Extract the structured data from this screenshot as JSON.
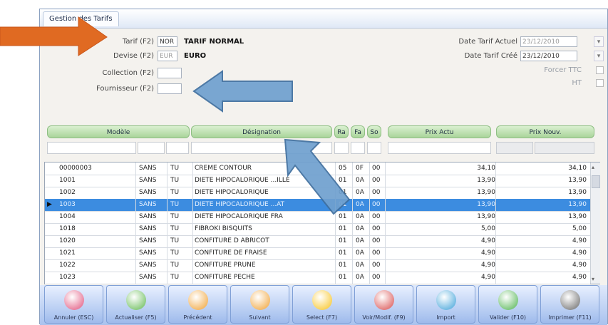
{
  "window": {
    "tab_label": "Gestion des Tarifs"
  },
  "form": {
    "tarif_label": "Tarif (F2)",
    "tarif_code": "NOR",
    "tarif_name": "TARIF NORMAL",
    "devise_label": "Devise (F2)",
    "devise_code": "EUR",
    "devise_name": "EURO",
    "collection_label": "Collection (F2)",
    "fournisseur_label": "Fournisseur (F2)",
    "date_actuel_label": "Date Tarif Actuel",
    "date_actuel": "23/12/2010",
    "date_cree_label": "Date Tarif Créé",
    "date_cree": "23/12/2010",
    "forcer_ttc_label": "Forcer TTC",
    "ht_label": "HT"
  },
  "columns": {
    "modele": "Modèle",
    "designation": "Désignation",
    "ra": "Ra",
    "fa": "Fa",
    "so": "So",
    "prix_actu": "Prix Actu",
    "prix_nouv": "Prix Nouv."
  },
  "rows": [
    {
      "modele": "00000003",
      "c1": "SANS",
      "c2": "TU",
      "designation": "CREME CONTOUR",
      "ra": "05",
      "fa": "0F",
      "so": "00",
      "prix_actu": "34,10",
      "prix_nouv": "34,10"
    },
    {
      "modele": "1001",
      "c1": "SANS",
      "c2": "TU",
      "designation": "DIETE HIPOCALORIQUE ...ILLE",
      "ra": "01",
      "fa": "0A",
      "so": "00",
      "prix_actu": "13,90",
      "prix_nouv": "13,90"
    },
    {
      "modele": "1002",
      "c1": "SANS",
      "c2": "TU",
      "designation": "DIETE HIPOCALORIQUE",
      "ra": "01",
      "fa": "0A",
      "so": "00",
      "prix_actu": "13,90",
      "prix_nouv": "13,90"
    },
    {
      "modele": "1003",
      "c1": "SANS",
      "c2": "TU",
      "designation": "DIETE HIPOCALORIQUE ...AT",
      "ra": "01",
      "fa": "0A",
      "so": "00",
      "prix_actu": "13,90",
      "prix_nouv": "13,90"
    },
    {
      "modele": "1004",
      "c1": "SANS",
      "c2": "TU",
      "designation": "DIETE HIPOCALORIQUE FRA",
      "ra": "01",
      "fa": "0A",
      "so": "00",
      "prix_actu": "13,90",
      "prix_nouv": "13,90"
    },
    {
      "modele": "1018",
      "c1": "SANS",
      "c2": "TU",
      "designation": "FIBROKI BISQUITS",
      "ra": "01",
      "fa": "0A",
      "so": "00",
      "prix_actu": "5,00",
      "prix_nouv": "5,00"
    },
    {
      "modele": "1020",
      "c1": "SANS",
      "c2": "TU",
      "designation": "CONFITURE D ABRICOT",
      "ra": "01",
      "fa": "0A",
      "so": "00",
      "prix_actu": "4,90",
      "prix_nouv": "4,90"
    },
    {
      "modele": "1021",
      "c1": "SANS",
      "c2": "TU",
      "designation": "CONFITURE DE FRAISE",
      "ra": "01",
      "fa": "0A",
      "so": "00",
      "prix_actu": "4,90",
      "prix_nouv": "4,90"
    },
    {
      "modele": "1022",
      "c1": "SANS",
      "c2": "TU",
      "designation": "CONFITURE PRUNE",
      "ra": "01",
      "fa": "0A",
      "so": "00",
      "prix_actu": "4,90",
      "prix_nouv": "4,90"
    },
    {
      "modele": "1023",
      "c1": "SANS",
      "c2": "TU",
      "designation": "CONFITURE PECHE",
      "ra": "01",
      "fa": "0A",
      "so": "00",
      "prix_actu": "4,90",
      "prix_nouv": "4,90"
    }
  ],
  "buttons": [
    {
      "label": "Annuler (ESC)",
      "icon": "cancel-icon",
      "color": "#e0507a"
    },
    {
      "label": "Actualiser (F5)",
      "icon": "refresh-icon",
      "color": "#5fb84e"
    },
    {
      "label": "Précédent",
      "icon": "previous-icon",
      "color": "#f0a030"
    },
    {
      "label": "Suivant",
      "icon": "next-icon",
      "color": "#f0a030"
    },
    {
      "label": "Select (F7)",
      "icon": "lightning-icon",
      "color": "#f7c21a"
    },
    {
      "label": "Voir/Modif. (F9)",
      "icon": "edit-icon",
      "color": "#d84a4a"
    },
    {
      "label": "Import",
      "icon": "import-icon",
      "color": "#3aa0d8"
    },
    {
      "label": "Valider (F10)",
      "icon": "validate-icon",
      "color": "#4cb24c"
    },
    {
      "label": "Imprimer (F11)",
      "icon": "printer-icon",
      "color": "#666666"
    }
  ],
  "colors": {
    "selection": "#3c8ce0",
    "header_green": "#a9d49a",
    "button_blue": "#9fbbec",
    "arrow_orange": "#e06a22",
    "arrow_blue": "#6fa0cf"
  }
}
